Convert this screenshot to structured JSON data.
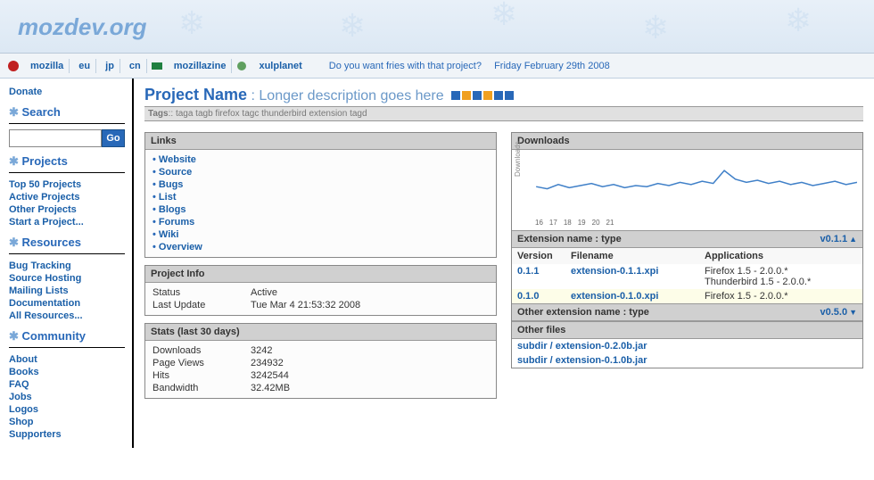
{
  "site": {
    "title": "mozdev.org"
  },
  "topnav": {
    "items": [
      "mozilla",
      "eu",
      "jp",
      "cn",
      "mozillazine",
      "xulplanet"
    ],
    "promo": "Do you want fries with that project?",
    "date": "Friday February 29th 2008"
  },
  "sidebar": {
    "donate": "Donate",
    "search_h": "Search",
    "search_btn": "Go",
    "projects_h": "Projects",
    "projects": [
      "Top 50 Projects",
      "Active Projects",
      "Other Projects",
      "Start a Project..."
    ],
    "resources_h": "Resources",
    "resources": [
      "Bug Tracking",
      "Source Hosting",
      "Mailing Lists",
      "Documentation",
      "All Resources..."
    ],
    "community_h": "Community",
    "community": [
      "About",
      "Books",
      "FAQ",
      "Jobs",
      "Logos",
      "Shop",
      "Supporters"
    ]
  },
  "project": {
    "name": "Project Name",
    "sep": " : ",
    "desc": "Longer description goes here",
    "tags_label": "Tags",
    "tags": ":: taga tagb firefox tagc thunderbird extension tagd",
    "square_colors": [
      "#2868b8",
      "#f0a020",
      "#2868b8",
      "#f0a020",
      "#2868b8",
      "#2868b8"
    ]
  },
  "links": {
    "h": "Links",
    "items": [
      "Website",
      "Source",
      "Bugs",
      "List",
      "Blogs",
      "Forums",
      "Wiki",
      "Overview"
    ]
  },
  "info": {
    "h": "Project Info",
    "rows": [
      {
        "k": "Status",
        "v": "Active"
      },
      {
        "k": "Last Update",
        "v": "Tue Mar 4 21:53:32 2008"
      }
    ]
  },
  "stats": {
    "h": "Stats (last 30 days)",
    "rows": [
      {
        "k": "Downloads",
        "v": "3242"
      },
      {
        "k": "Page Views",
        "v": "234932"
      },
      {
        "k": "Hits",
        "v": "3242544"
      },
      {
        "k": "Bandwidth",
        "v": "32.42MB"
      }
    ]
  },
  "downloads": {
    "h": "Downloads",
    "ylabel": "Downloads",
    "xticks": [
      "16",
      "17",
      "18",
      "19",
      "20",
      "21"
    ],
    "ext1": {
      "name": "Extension name : type",
      "ver": "v0.1.1"
    },
    "filehdr": {
      "c1": "Version",
      "c2": "Filename",
      "c3": "Applications"
    },
    "files": [
      {
        "ver": "0.1.1",
        "fn": "extension-0.1.1.xpi",
        "apps": "Firefox 1.5 - 2.0.0.*",
        "apps2": "Thunderbird 1.5 - 2.0.0.*"
      },
      {
        "ver": "0.1.0",
        "fn": "extension-0.1.0.xpi",
        "apps": "Firefox 1.5 - 2.0.0.*"
      }
    ],
    "ext2": {
      "name": "Other extension name : type",
      "ver": "v0.5.0"
    },
    "other_h": "Other files",
    "other": [
      "subdir / extension-0.2.0b.jar",
      "subdir / extension-0.1.0b.jar"
    ]
  },
  "chart_data": {
    "type": "line",
    "title": "Downloads",
    "ylabel": "Downloads",
    "x": [
      1,
      2,
      3,
      4,
      5,
      6,
      7,
      8,
      9,
      10,
      11,
      12,
      13,
      14,
      15,
      16,
      17,
      18,
      19,
      20,
      21,
      22,
      23,
      24,
      25,
      26,
      27,
      28,
      29,
      30
    ],
    "values": [
      48,
      44,
      52,
      46,
      50,
      54,
      48,
      52,
      46,
      50,
      48,
      54,
      50,
      56,
      52,
      58,
      54,
      78,
      62,
      56,
      60,
      54,
      58,
      52,
      56,
      50,
      54,
      58,
      52,
      56
    ],
    "xlabel": "",
    "ylim": [
      0,
      100
    ]
  }
}
